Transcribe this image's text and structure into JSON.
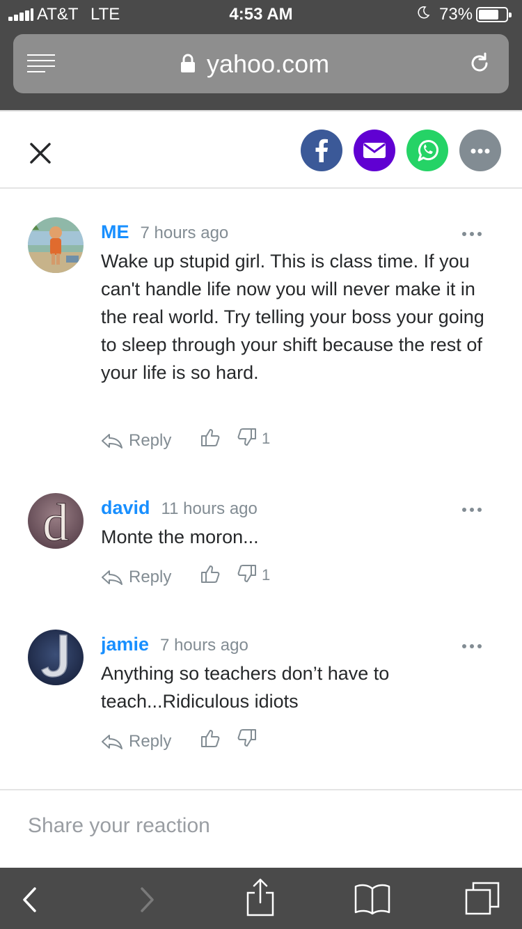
{
  "status_bar": {
    "carrier": "AT&T",
    "network": "LTE",
    "time": "4:53 AM",
    "battery": "73%",
    "battery_level": 0.73
  },
  "browser": {
    "url": "yahoo.com",
    "secure": true
  },
  "share_bar": {
    "buttons": [
      {
        "name": "facebook",
        "color": "#3b5998",
        "icon": "facebook-icon"
      },
      {
        "name": "email",
        "color": "#6001d2",
        "icon": "mail-icon"
      },
      {
        "name": "whatsapp",
        "color": "#25d366",
        "icon": "whatsapp-icon"
      },
      {
        "name": "more",
        "color": "#828c93",
        "icon": "more-icon"
      }
    ]
  },
  "comments": [
    {
      "user": "ME",
      "time": "7 hours ago",
      "text": "Wake up stupid girl. This is class time. If you can't handle life now you will never make it in the real world. Try telling your boss your going to sleep through your shift because the rest of your life is so hard.",
      "reply_label": "Reply",
      "dislikes": "1",
      "avatar": "cartoon-avatar"
    },
    {
      "user": "david",
      "time": "11 hours ago",
      "text": "Monte the moron...",
      "reply_label": "Reply",
      "dislikes": "1",
      "avatar": "letter-d-avatar"
    },
    {
      "user": "jamie",
      "time": "7 hours ago",
      "text": "Anything so teachers don’t have to teach...Ridiculous idiots",
      "reply_label": "Reply",
      "dislikes": "",
      "avatar": "letter-j-avatar"
    }
  ],
  "reaction_input": {
    "placeholder": "Share your reaction"
  },
  "colors": {
    "username": "#188fff",
    "meta": "#828c93",
    "chrome": "#4a4a4a"
  }
}
